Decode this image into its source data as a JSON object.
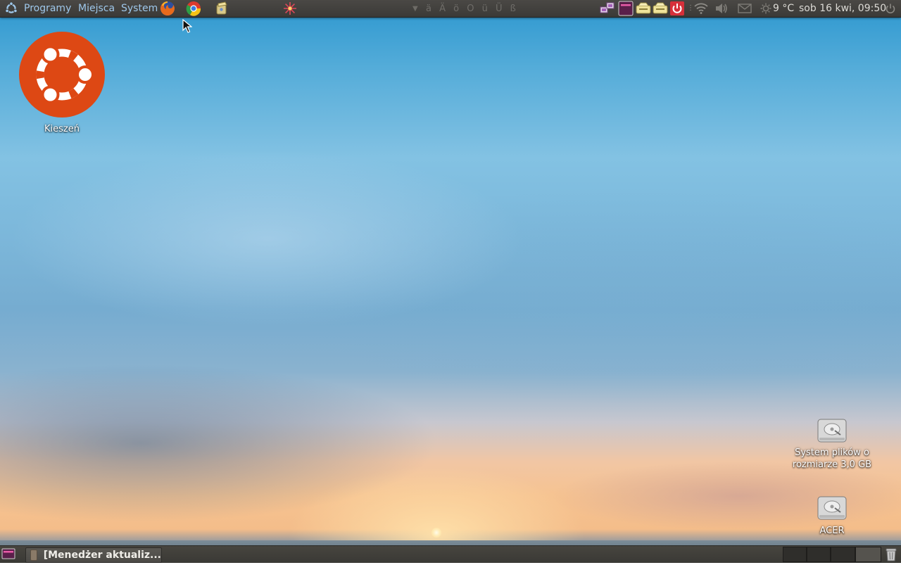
{
  "top_panel": {
    "menu_programs": "Programy",
    "menu_places": "Miejsca",
    "menu_system": "System",
    "special_chars": "ä Ä ö O ü Ü ß",
    "temperature": "9 °C",
    "clock": "sob 16 kwi, 09:50"
  },
  "desktop": {
    "home_folder_label": "Kieszeń",
    "drive1_label_line1": "System plików o",
    "drive1_label_line2": "rozmiarze 3,0 GB",
    "drive2_label": "ACER"
  },
  "bottom_panel": {
    "task_label": "[Menedżer aktualiz..."
  },
  "colors": {
    "ubuntu_orange": "#dd4814",
    "panel_bg": "#3c3b37"
  }
}
